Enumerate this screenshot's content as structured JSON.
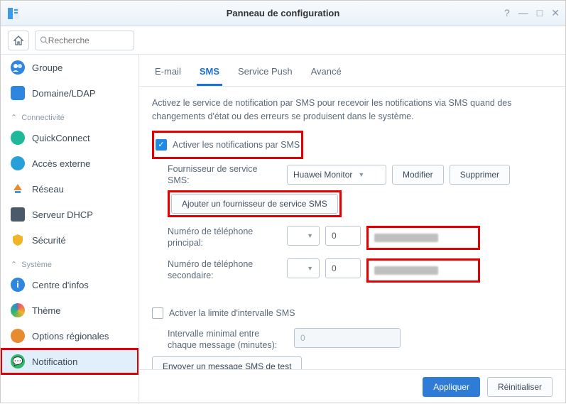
{
  "window": {
    "title": "Panneau de configuration"
  },
  "search": {
    "placeholder": "Recherche"
  },
  "sidebar": {
    "items": [
      {
        "label": "Groupe"
      },
      {
        "label": "Domaine/LDAP"
      }
    ],
    "section_connectivity": "Connectivité",
    "conn_items": [
      {
        "label": "QuickConnect"
      },
      {
        "label": "Accès externe"
      },
      {
        "label": "Réseau"
      },
      {
        "label": "Serveur DHCP"
      },
      {
        "label": "Sécurité"
      }
    ],
    "section_system": "Système",
    "sys_items": [
      {
        "label": "Centre d'infos"
      },
      {
        "label": "Thème"
      },
      {
        "label": "Options régionales"
      },
      {
        "label": "Notification"
      }
    ]
  },
  "tabs": {
    "email": "E-mail",
    "sms": "SMS",
    "push": "Service Push",
    "advanced": "Avancé"
  },
  "sms": {
    "description": "Activez le service de notification par SMS pour recevoir les notifications via SMS quand des changements d'état ou des erreurs se produisent dans le système.",
    "enable_label": "Activer les notifications par SMS",
    "provider_label": "Fournisseur de service SMS:",
    "provider_value": "Huawei Monitor",
    "modify_btn": "Modifier",
    "delete_btn": "Supprimer",
    "add_provider_btn": "Ajouter un fournisseur de service SMS",
    "primary_phone_label": "Numéro de téléphone principal:",
    "secondary_phone_label": "Numéro de téléphone secondaire:",
    "dial_code": "0",
    "interval_enable_label": "Activer la limite d'intervalle SMS",
    "interval_label": "Intervalle minimal entre chaque message (minutes):",
    "interval_value": "0",
    "test_btn": "Envoyer un message SMS de test"
  },
  "footer": {
    "apply": "Appliquer",
    "reset": "Réinitialiser"
  }
}
